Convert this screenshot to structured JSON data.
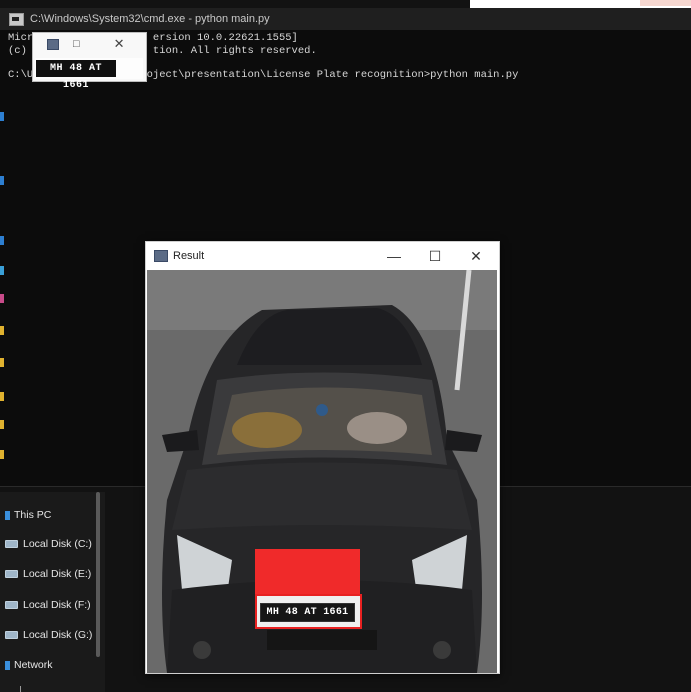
{
  "cmd": {
    "title": "C:\\Windows\\System32\\cmd.exe - python  main.py",
    "line1": "Micr                   ersion 10.0.22621.1555]",
    "line2": "(c)                    tion. All rights reserved.",
    "prompt": "C:\\Users\\HP\\Desktop\\project\\presentation\\License Plate recognition>python main.py"
  },
  "mini_window": {
    "plate_text": "MH 48 AT 1661",
    "ctrl_min": "—",
    "ctrl_max": "□",
    "ctrl_close": "✕"
  },
  "nav": {
    "items": [
      {
        "label": "This PC",
        "icon": "pc-icon"
      },
      {
        "label": "Local Disk (C:)",
        "icon": "drive-icon"
      },
      {
        "label": "Local Disk (E:)",
        "icon": "drive-icon"
      },
      {
        "label": "Local Disk (F:)",
        "icon": "drive-icon"
      },
      {
        "label": "Local Disk (G:)",
        "icon": "drive-icon"
      },
      {
        "label": "Network",
        "icon": "network-icon"
      }
    ]
  },
  "result_window": {
    "title": "Result",
    "btn_min": "—",
    "btn_max": "☐",
    "btn_close": "✕",
    "plate_text": "MH 48 AT 1661"
  },
  "colors": {
    "detection_box": "#e82121",
    "terminal_bg": "#0c0c0c"
  }
}
